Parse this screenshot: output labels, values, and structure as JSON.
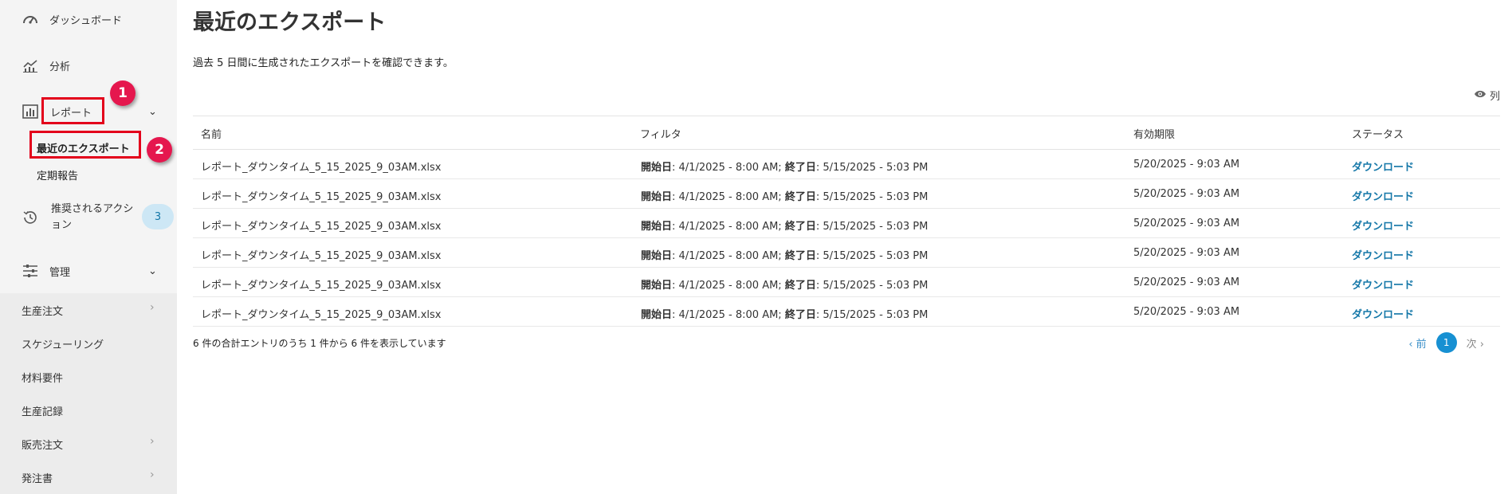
{
  "sidebar": {
    "dashboard": "ダッシュボード",
    "analytics": "分析",
    "reports": "レポート",
    "recent_exports": "最近のエクスポート",
    "scheduled_reports": "定期報告",
    "recommended_actions": "推奨されるアクション",
    "recommended_count": "3",
    "admin": "管理",
    "admin_items": [
      "生産注文",
      "スケジューリング",
      "材料要件",
      "生産記録",
      "販売注文",
      "発注書"
    ]
  },
  "annotations": {
    "step1": "1",
    "step2": "2"
  },
  "page": {
    "title": "最近のエクスポート",
    "description": "過去 5 日間に生成されたエクスポートを確認できます。",
    "columns_label": "列"
  },
  "table": {
    "headers": [
      "名前",
      "フィルタ",
      "有効期限",
      "ステータス"
    ],
    "rows": [
      {
        "name": "レポート_ダウンタイム_5_15_2025_9_03AM.xlsx",
        "start_label": "開始日",
        "start": ": 4/1/2025 - 8:00 AM; ",
        "end_label": "終了日",
        "end": ": 5/15/2025 - 5:03 PM",
        "expiry": "5/20/2025 - 9:03 AM",
        "status": "ダウンロード"
      },
      {
        "name": "レポート_ダウンタイム_5_15_2025_9_03AM.xlsx",
        "start_label": "開始日",
        "start": ": 4/1/2025 - 8:00 AM; ",
        "end_label": "終了日",
        "end": ": 5/15/2025 - 5:03 PM",
        "expiry": "5/20/2025 - 9:03 AM",
        "status": "ダウンロード"
      },
      {
        "name": "レポート_ダウンタイム_5_15_2025_9_03AM.xlsx",
        "start_label": "開始日",
        "start": ": 4/1/2025 - 8:00 AM; ",
        "end_label": "終了日",
        "end": ": 5/15/2025 - 5:03 PM",
        "expiry": "5/20/2025 - 9:03 AM",
        "status": "ダウンロード"
      },
      {
        "name": "レポート_ダウンタイム_5_15_2025_9_03AM.xlsx",
        "start_label": "開始日",
        "start": ": 4/1/2025 - 8:00 AM; ",
        "end_label": "終了日",
        "end": ": 5/15/2025 - 5:03 PM",
        "expiry": "5/20/2025 - 9:03 AM",
        "status": "ダウンロード"
      },
      {
        "name": "レポート_ダウンタイム_5_15_2025_9_03AM.xlsx",
        "start_label": "開始日",
        "start": ": 4/1/2025 - 8:00 AM; ",
        "end_label": "終了日",
        "end": ": 5/15/2025 - 5:03 PM",
        "expiry": "5/20/2025 - 9:03 AM",
        "status": "ダウンロード"
      },
      {
        "name": "レポート_ダウンタイム_5_15_2025_9_03AM.xlsx",
        "start_label": "開始日",
        "start": ": 4/1/2025 - 8:00 AM; ",
        "end_label": "終了日",
        "end": ": 5/15/2025 - 5:03 PM",
        "expiry": "5/20/2025 - 9:03 AM",
        "status": "ダウンロード"
      }
    ]
  },
  "footer": {
    "summary": "6 件の合計エントリのうち 1 件から 6 件を表示しています",
    "prev": "‹ 前",
    "current_page": "1",
    "next": "次 ›"
  }
}
